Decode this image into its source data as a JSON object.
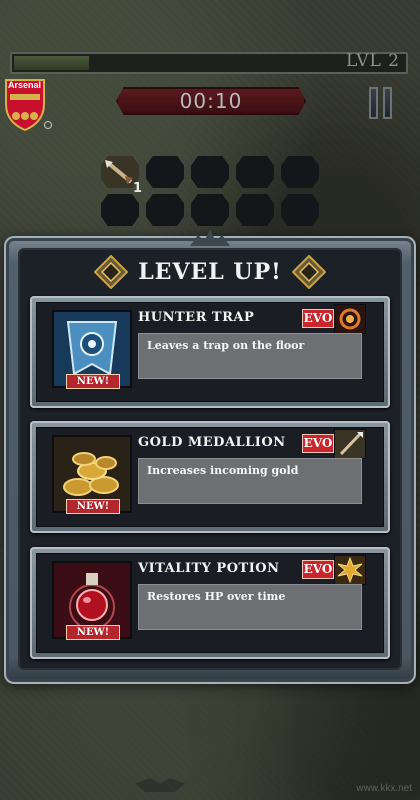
{
  "hud": {
    "level_label": "LVL 2",
    "xp_progress": 0.2,
    "timer": "00:10",
    "crest_name": "Arsenal",
    "slot_count": "1"
  },
  "modal": {
    "title": "LEVEL UP!",
    "options": [
      {
        "name": "HUNTER TRAP",
        "description": "Leaves a trap on the floor",
        "new_label": "NEW!",
        "evo_label": "EVO",
        "icon": "hunter-trap-icon",
        "evo_icon": "evo-swirl-icon"
      },
      {
        "name": "GOLD MEDALLION",
        "description": "Increases incoming gold",
        "new_label": "NEW!",
        "evo_label": "EVO",
        "icon": "gold-coins-icon",
        "evo_icon": "evo-spear-icon"
      },
      {
        "name": "VITALITY POTION",
        "description": "Restores HP over time",
        "new_label": "NEW!",
        "evo_label": "EVO",
        "icon": "red-potion-icon",
        "evo_icon": "evo-sun-icon"
      }
    ]
  },
  "watermark": "www.kkx.net",
  "colors": {
    "new_badge": "#b3262b",
    "evo_badge": "#c8262c",
    "timer_bg": "#5a1a1e"
  }
}
